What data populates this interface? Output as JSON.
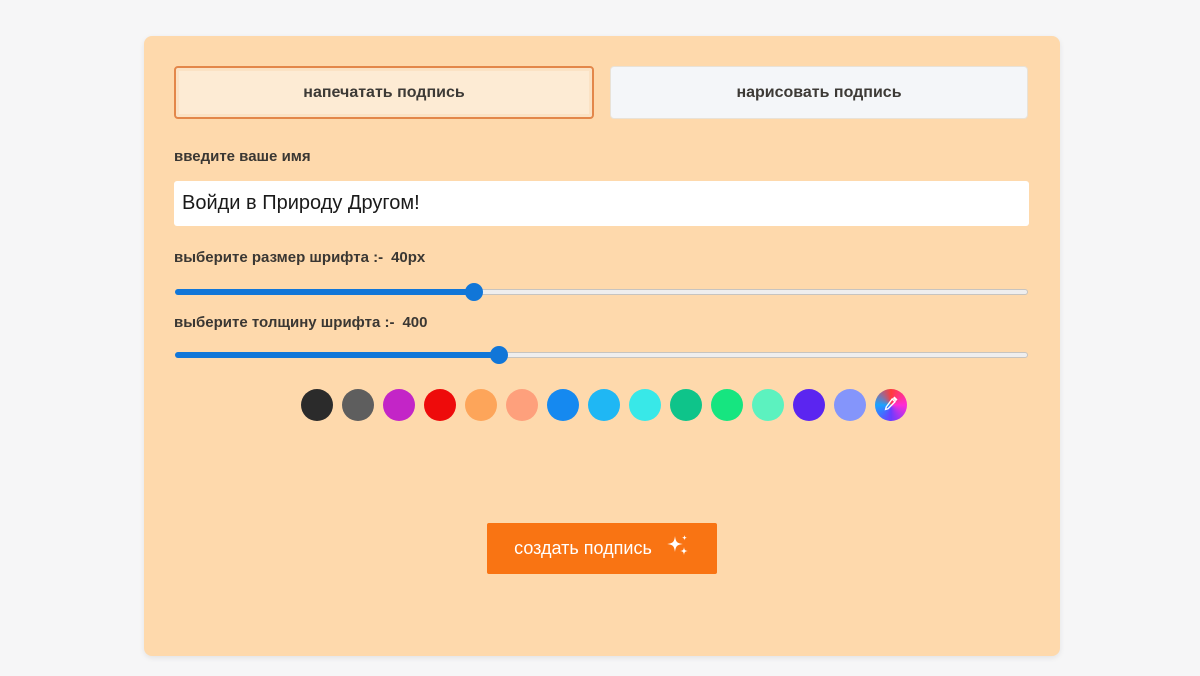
{
  "tabs": {
    "type_label": "напечатать подпись",
    "draw_label": "нарисовать подпись",
    "active": "type"
  },
  "name": {
    "label": "введите ваше имя",
    "value": "Войди в Природу Другом!"
  },
  "font_size": {
    "label": "выберите размер шрифта :-",
    "value_text": "40px",
    "fraction": 0.35
  },
  "font_weight": {
    "label": "выберите толщину шрифта :-",
    "value_text": "400",
    "fraction": 0.38
  },
  "colors": [
    "#2b2b2b",
    "#5e5e5e",
    "#c325c7",
    "#ee0b0b",
    "#fda55a",
    "#fea07c",
    "#1589f0",
    "#1fb7f4",
    "#38e8e8",
    "#0ec48a",
    "#16e580",
    "#5cf2bf",
    "#5b25f0",
    "#8495fb"
  ],
  "color_picker_icon": "eyedropper-icon",
  "create_button": {
    "label": "создать подпись",
    "icon": "sparkles-icon"
  }
}
